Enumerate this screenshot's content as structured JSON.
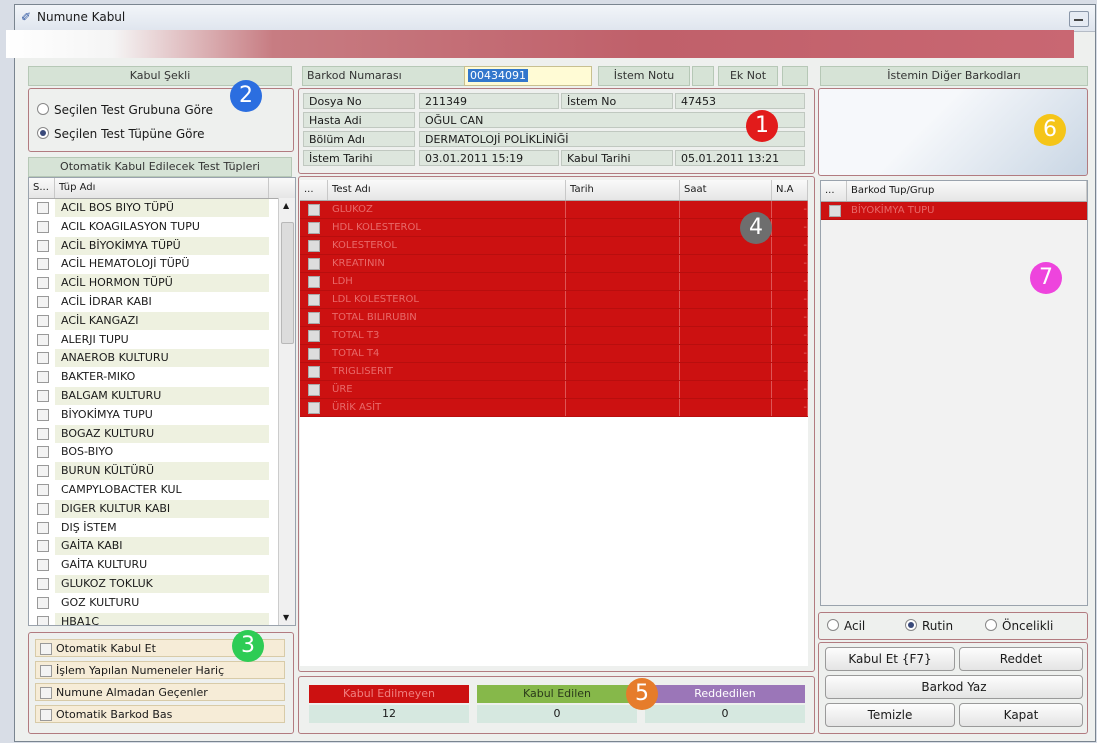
{
  "window": {
    "title": "Numune Kabul"
  },
  "kabul": {
    "header": "Kabul Şekli",
    "options": [
      "Seçilen Test Grubuna Göre",
      "Seçilen Test Tüpüne Göre"
    ],
    "selected_index": 1
  },
  "tupler": {
    "header": "Otomatik Kabul Edilecek Test Tüpleri",
    "col_s": "S...",
    "col_name": "Tüp Adı",
    "items": [
      "ACIL BOS BIYO TÜPÜ",
      "ACIL KOAGILASYON TUPU",
      "ACİL BİYOKİMYA TÜPÜ",
      "ACİL HEMATOLOJİ TÜPÜ",
      "ACİL HORMON TÜPÜ",
      "ACİL İDRAR KABI",
      "ACİL KANGAZI",
      "ALERJI TUPU",
      "ANAEROB KULTURU",
      "BAKTER-MIKO",
      "BALGAM KULTURU",
      "BİYOKİMYA TUPU",
      "BOGAZ KULTURU",
      "BOS-BIYO",
      "BURUN KÜLTÜRÜ",
      "CAMPYLOBACTER KUL",
      "DIGER KULTUR KABI",
      "DIŞ İSTEM",
      "GAİTA KABI",
      "GAİTA KULTURU",
      "GLUKOZ TOKLUK",
      "GOZ KULTURU",
      "HBA1C"
    ]
  },
  "auto_options": [
    "Otomatik Kabul Et",
    "İşlem Yapılan Numeneler Hariç",
    "Numune Almadan Geçenler",
    "Otomatik Barkod Bas"
  ],
  "barkod": {
    "label": "Barkod Numarası",
    "value": "00434091",
    "istem_notu": "İstem Notu",
    "ek_not": "Ek Not"
  },
  "patient": {
    "dosya_no_label": "Dosya No",
    "dosya_no": "211349",
    "istem_no_label": "İstem No",
    "istem_no": "47453",
    "hasta_adi_label": "Hasta Adi",
    "hasta_adi": "OĞUL CAN",
    "bolum_adi_label": "Bölüm Adı",
    "bolum_adi": "DERMATOLOJİ POLİKLİNİĞİ",
    "istem_tarihi_label": "İstem Tarihi",
    "istem_tarihi": "03.01.2011 15:19",
    "kabul_tarihi_label": "Kabul Tarihi",
    "kabul_tarihi": "05.01.2011 13:21"
  },
  "tests": {
    "col_dots": "...",
    "col_name": "Test Adı",
    "col_tarih": "Tarih",
    "col_saat": "Saat",
    "col_na": "N.A",
    "rows": [
      "GLUKOZ",
      "HDL KOLESTEROL",
      "KOLESTEROL",
      "KREATININ",
      "LDH",
      "LDL KOLESTEROL",
      "TOTAL BILIRUBIN",
      "TOTAL T3",
      "TOTAL T4",
      "TRIGLISERIT",
      "ÜRE",
      "ÜRİK ASİT"
    ],
    "na_dash": "-"
  },
  "status": {
    "kabul_edilmeyen": "Kabul Edilmeyen",
    "kabul_edilmeyen_count": "12",
    "kabul_edilen": "Kabul Edilen",
    "kabul_edilen_count": "0",
    "reddedilen": "Reddedilen",
    "reddedilen_count": "0",
    "colors": {
      "red": "#cc1111",
      "green": "#86b84a",
      "purple": "#9b76b8"
    }
  },
  "other_barcodes": {
    "header": "İstemin Diğer Barkodları",
    "col_dots": "...",
    "col_name": "Barkod Tup/Grup",
    "rows": [
      "BİYOKİMYA TUPU"
    ]
  },
  "priority": {
    "options": [
      "Acil",
      "Rutin",
      "Öncelikli"
    ],
    "selected_index": 1
  },
  "buttons": {
    "kabul_et": "Kabul Et {F7}",
    "reddet": "Reddet",
    "barkod_yaz": "Barkod Yaz",
    "temizle": "Temizle",
    "kapat": "Kapat"
  },
  "badges": [
    "1",
    "2",
    "3",
    "4",
    "5",
    "6",
    "7"
  ]
}
